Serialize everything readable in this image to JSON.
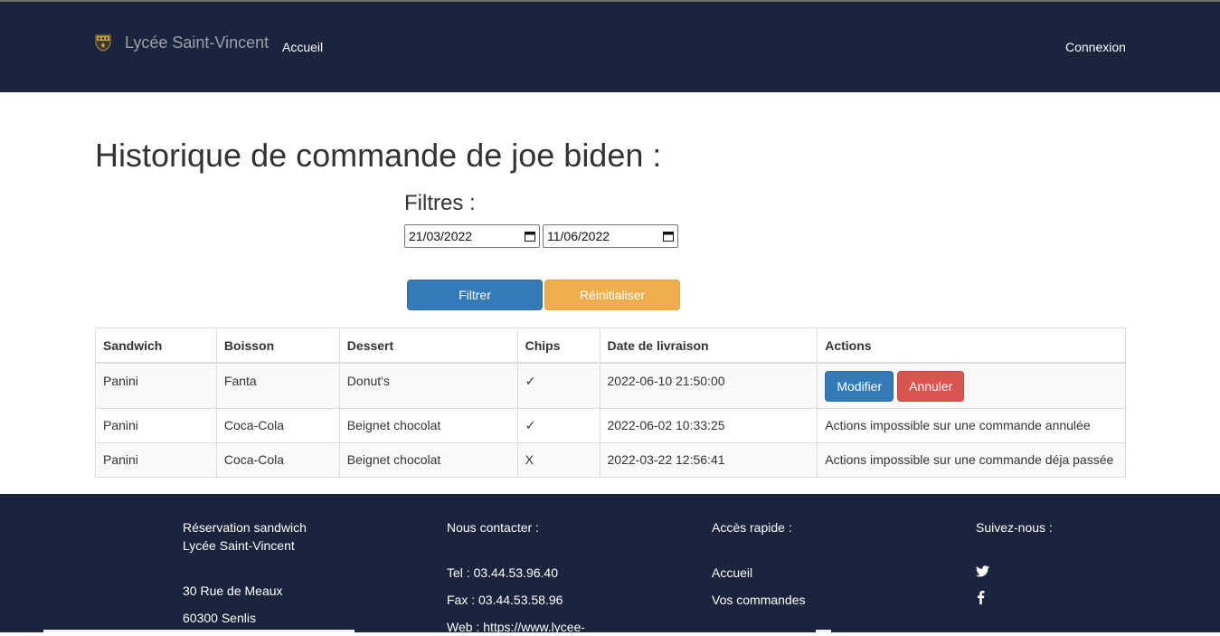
{
  "nav": {
    "brand": "Lycée Saint-Vincent",
    "home": "Accueil",
    "login": "Connexion"
  },
  "main": {
    "title": "Historique de commande de joe biden :",
    "filters_title": "Filtres :",
    "date_from": "21/03/2022",
    "date_to": "11/06/2022",
    "filter_button": "Filtrer",
    "reset_button": "Réinitialiser"
  },
  "table": {
    "headers": [
      "Sandwich",
      "Boisson",
      "Dessert",
      "Chips",
      "Date de livraison",
      "Actions"
    ],
    "rows": [
      {
        "sandwich": "Panini",
        "boisson": "Fanta",
        "dessert": "Donut's",
        "chips": "✓",
        "date": "2022-06-10 21:50:00",
        "modify": "Modifier",
        "cancel": "Annuler"
      },
      {
        "sandwich": "Panini",
        "boisson": "Coca-Cola",
        "dessert": "Beignet chocolat",
        "chips": "✓",
        "date": "2022-06-02 10:33:25",
        "actions": "Actions impossible sur une commande annulée"
      },
      {
        "sandwich": "Panini",
        "boisson": "Coca-Cola",
        "dessert": "Beignet chocolat",
        "chips": "X",
        "date": "2022-03-22 12:56:41",
        "actions": "Actions impossible sur une commande déja passée"
      }
    ]
  },
  "footer": {
    "col1": {
      "line1": "Réservation sandwich",
      "line2": "Lycée Saint-Vincent",
      "address": "30 Rue de Meaux",
      "city": "60300 Senlis"
    },
    "col2": {
      "title": "Nous contacter :",
      "tel": "Tel : 03.44.53.96.40",
      "fax": "Fax : 03.44.53.58.96",
      "web": "Web : https://www.lycee-"
    },
    "col3": {
      "title": "Accès rapide :",
      "link1": "Accueil",
      "link2": "Vos commandes"
    },
    "col4": {
      "title": "Suivez-nous :",
      "icons": [
        "twitter-icon",
        "facebook-icon"
      ]
    }
  },
  "colors": {
    "navbar": "#1a243d",
    "primary": "#337ab7",
    "warning": "#f0ad4e",
    "danger": "#d9534f"
  }
}
